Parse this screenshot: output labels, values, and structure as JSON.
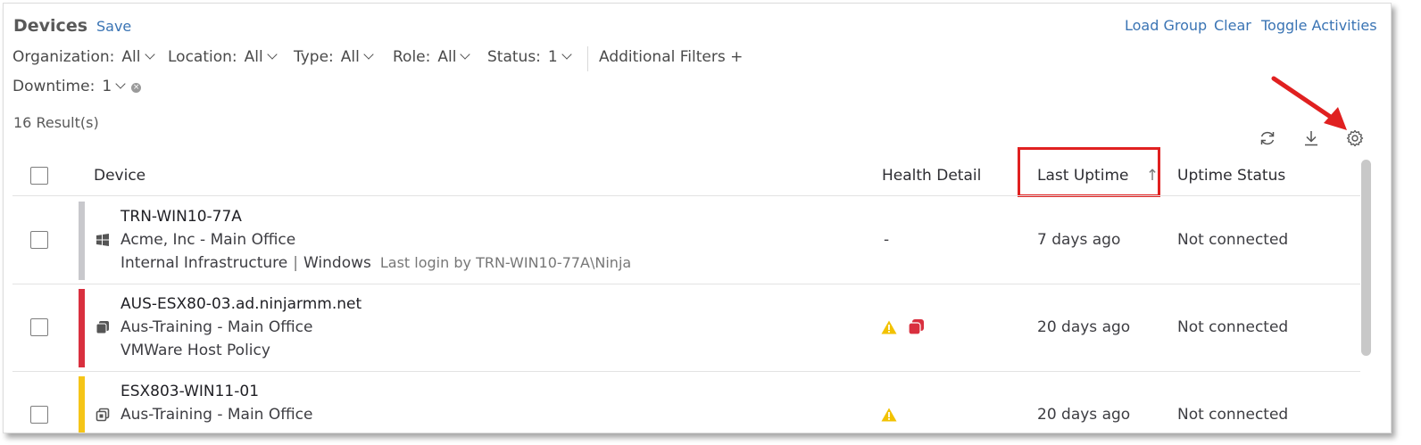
{
  "header": {
    "title": "Devices",
    "save_label": "Save",
    "load_group_label": "Load Group",
    "clear_label": "Clear",
    "toggle_activities_label": "Toggle Activities"
  },
  "filters": {
    "organization": {
      "label": "Organization:",
      "value": "All"
    },
    "location": {
      "label": "Location:",
      "value": "All"
    },
    "type": {
      "label": "Type:",
      "value": "All"
    },
    "role": {
      "label": "Role:",
      "value": "All"
    },
    "status": {
      "label": "Status:",
      "value": "1"
    },
    "additional": "Additional Filters +",
    "downtime": {
      "label": "Downtime:",
      "value": "1"
    }
  },
  "results_label": "16 Result(s)",
  "toolbar_icons": [
    "refresh-icon",
    "download-icon",
    "gear-icon"
  ],
  "table": {
    "columns": {
      "device": "Device",
      "health_detail": "Health Detail",
      "last_uptime": "Last Uptime",
      "uptime_status": "Uptime Status"
    },
    "sort_indicator": "↑",
    "rows": [
      {
        "name": "TRN-WIN10-77A",
        "org": "Acme, Inc - Main Office",
        "role": "Internal Infrastructure",
        "os": "Windows",
        "login": "Last login by TRN-WIN10-77A\\Ninja",
        "health": "-",
        "last_uptime": "7 days ago",
        "uptime_status": "Not connected",
        "status_color": "#c8c8cc",
        "device_icon": "windows-icon"
      },
      {
        "name": "AUS-ESX80-03.ad.ninjarmm.net",
        "org": "Aus-Training - Main Office",
        "policy": "VMWare Host Policy",
        "health_icons": [
          "warning-icon",
          "critical-stack-icon"
        ],
        "last_uptime": "20 days ago",
        "uptime_status": "Not connected",
        "status_color": "#d9303f",
        "device_icon": "vm-host-icon"
      },
      {
        "name": "ESX803-WIN11-01",
        "org": "Aus-Training - Main Office",
        "health_icons": [
          "warning-icon"
        ],
        "last_uptime": "20 days ago",
        "uptime_status": "Not connected",
        "status_color": "#f5c518",
        "device_icon": "vm-guest-icon"
      }
    ]
  },
  "annotation": {
    "arrow_color": "#e02020",
    "box_color": "#e02020"
  }
}
